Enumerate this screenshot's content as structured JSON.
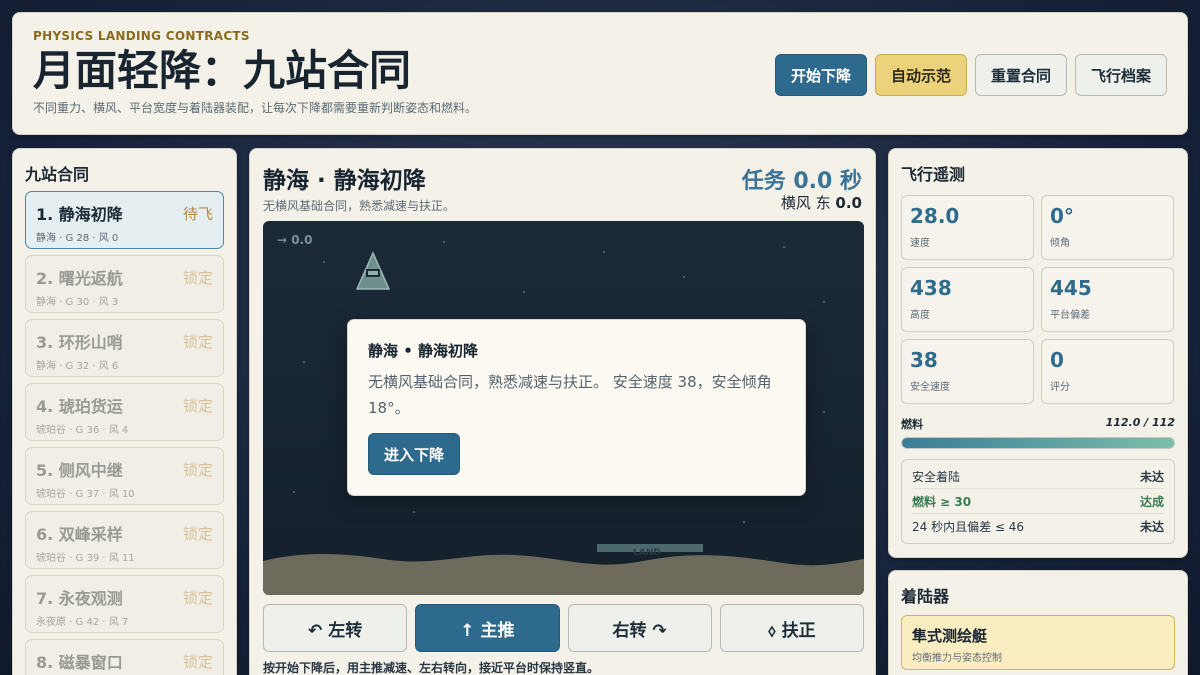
{
  "header": {
    "kicker": "PHYSICS LANDING CONTRACTS",
    "title": "月面轻降：九站合同",
    "subtitle": "不同重力、横风、平台宽度与着陆器装配，让每次下降都需要重新判断姿态和燃料。",
    "buttons": {
      "start": "开始下降",
      "demo": "自动示范",
      "reset": "重置合同",
      "log": "飞行档案"
    }
  },
  "contracts": {
    "title": "九站合同",
    "items": [
      {
        "name": "1. 静海初降",
        "meta": "静海 · G 28 · 风 0",
        "state": "待飞"
      },
      {
        "name": "2. 曙光返航",
        "meta": "静海 · G 30 · 风 3",
        "state": "锁定"
      },
      {
        "name": "3. 环形山哨",
        "meta": "静海 · G 32 · 风 6",
        "state": "锁定"
      },
      {
        "name": "4. 琥珀货运",
        "meta": "琥珀谷 · G 36 · 风 4",
        "state": "锁定"
      },
      {
        "name": "5. 侧风中继",
        "meta": "琥珀谷 · G 37 · 风 10",
        "state": "锁定"
      },
      {
        "name": "6. 双峰采样",
        "meta": "琥珀谷 · G 39 · 风 11",
        "state": "锁定"
      },
      {
        "name": "7. 永夜观测",
        "meta": "永夜原 · G 42 · 风 7",
        "state": "锁定"
      },
      {
        "name": "8. 磁暴窗口",
        "meta": "",
        "state": "锁定"
      }
    ]
  },
  "mission": {
    "title": "静海 · 静海初降",
    "subtitle": "无横风基础合同，熟悉减速与扶正。",
    "timer": "任务 0.0 秒",
    "wind_label": "横风 东",
    "wind_value": "0.0",
    "velocity_readout": "→ 0.0",
    "pad_label": "LAND",
    "modal": {
      "title": "静海 • 静海初降",
      "body": "无横风基础合同，熟悉减速与扶正。 安全速度 38，安全倾角 18°。",
      "button": "进入下降"
    },
    "controls": {
      "left": "↶ 左转",
      "thrust": "↑ 主推",
      "right": "右转 ↷",
      "level": "⬨ 扶正"
    },
    "hint": "按开始下降后，用主推减速、左右转向，接近平台时保持竖直。"
  },
  "telemetry": {
    "title": "飞行遥测",
    "tiles": [
      {
        "value": "28.0",
        "label": "速度"
      },
      {
        "value": "0°",
        "label": "倾角"
      },
      {
        "value": "438",
        "label": "高度"
      },
      {
        "value": "445",
        "label": "平台偏差"
      },
      {
        "value": "38",
        "label": "安全速度"
      },
      {
        "value": "0",
        "label": "评分"
      }
    ],
    "fuel_label": "燃料",
    "fuel_value": "112.0 / 112",
    "fuel_fraction": 1.0,
    "goals": [
      {
        "text": "安全着陆",
        "status": "未达",
        "ok": false
      },
      {
        "text": "燃料 ≥ 30",
        "status": "达成",
        "ok": true
      },
      {
        "text": "24 秒内且偏差 ≤ 46",
        "status": "未达",
        "ok": false
      }
    ]
  },
  "loadout": {
    "title": "着陆器",
    "vessel_name": "隼式测绘艇",
    "vessel_desc": "均衡推力与姿态控制"
  },
  "colors": {
    "primary": "#2e6a8e",
    "gold": "#ecd27a",
    "accent_text": "#3b7398",
    "ok": "#3b7b53"
  }
}
